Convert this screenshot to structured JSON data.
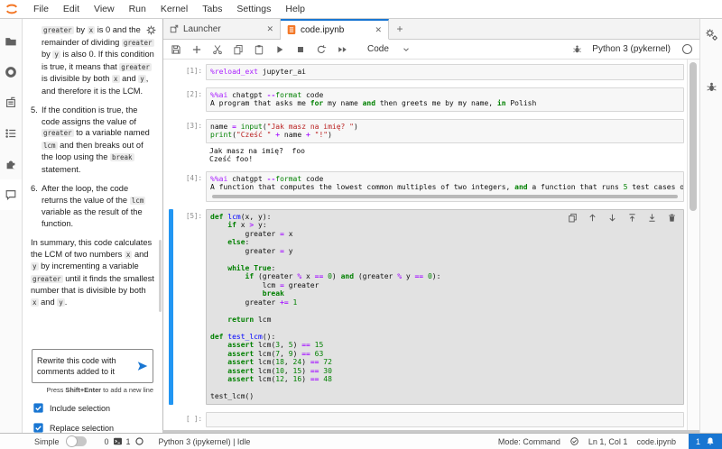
{
  "app": {
    "accent": "#1976d2",
    "selection_blue": "#2196f3",
    "brand_orange": "#f37726"
  },
  "menubar": {
    "items": [
      "File",
      "Edit",
      "View",
      "Run",
      "Kernel",
      "Tabs",
      "Settings",
      "Help"
    ]
  },
  "left_activity_bar": {
    "icons": [
      "file-browser",
      "running-kernels",
      "property-inspector",
      "table-of-contents",
      "extensions",
      "chat"
    ]
  },
  "chat_panel": {
    "paragraphs": [
      {
        "hang": true,
        "segments": [
          [
            "c",
            "greater"
          ],
          [
            "t",
            " by "
          ],
          [
            "c",
            "x"
          ],
          [
            "t",
            " is 0 and the remainder of dividing "
          ],
          [
            "c",
            "greater"
          ],
          [
            "t",
            " by "
          ],
          [
            "c",
            "y"
          ],
          [
            "t",
            " is also 0. If this condition is true, it means that "
          ],
          [
            "c",
            "greater"
          ],
          [
            "t",
            " is divisible by both "
          ],
          [
            "c",
            "x"
          ],
          [
            "t",
            " and "
          ],
          [
            "c",
            "y"
          ],
          [
            "t",
            ", and therefore it is the LCM."
          ]
        ]
      },
      {
        "num": "5.",
        "segments": [
          [
            "t",
            "If the condition is true, the code assigns the value of "
          ],
          [
            "c",
            "greater"
          ],
          [
            "t",
            " to a variable named "
          ],
          [
            "c",
            "lcm"
          ],
          [
            "t",
            " and then breaks out of the loop using the "
          ],
          [
            "c",
            "break"
          ],
          [
            "t",
            " statement."
          ]
        ]
      },
      {
        "num": "6.",
        "segments": [
          [
            "t",
            "After the loop, the code returns the value of the "
          ],
          [
            "c",
            "lcm"
          ],
          [
            "t",
            " variable as the result of the function."
          ]
        ]
      },
      {
        "segments": [
          [
            "t",
            "In summary, this code calculates the LCM of two numbers "
          ],
          [
            "c",
            "x"
          ],
          [
            "t",
            " and "
          ],
          [
            "c",
            "y"
          ],
          [
            "t",
            " by incrementing a variable "
          ],
          [
            "c",
            "greater"
          ],
          [
            "t",
            " until it finds the smallest number that is divisible by both "
          ],
          [
            "c",
            "x"
          ],
          [
            "t",
            " and "
          ],
          [
            "c",
            "y"
          ],
          [
            "t",
            "."
          ]
        ]
      }
    ],
    "input": {
      "value": "Rewrite this code with comments added to it"
    },
    "hint": {
      "prefix": "Press ",
      "key": "Shift+Enter",
      "suffix": " to add a new line"
    },
    "checkboxes": [
      {
        "label": "Include selection",
        "checked": true
      },
      {
        "label": "Replace selection",
        "checked": true
      }
    ]
  },
  "tab_bar": {
    "tabs": [
      {
        "label": "Launcher",
        "icon": "launcher-icon",
        "active": false
      },
      {
        "label": "code.ipynb",
        "icon": "notebook-icon",
        "active": true
      }
    ],
    "new_tab_label": "+"
  },
  "nb_toolbar": {
    "icons": [
      "save",
      "insert-cell-below",
      "cut-cells",
      "copy-cells",
      "paste-cells",
      "run-cell",
      "interrupt-kernel",
      "restart-kernel",
      "restart-and-run-all"
    ],
    "cell_type": "Code",
    "kernel_label": "Python 3 (pykernel)"
  },
  "right_activity_bar": {
    "icons": [
      "property-inspector-gears",
      "debugger-bug"
    ]
  },
  "cell_toolbar_icons": [
    "duplicate-cell",
    "move-cell-up",
    "move-cell-down",
    "insert-cell-above",
    "insert-cell-below",
    "delete-cell"
  ],
  "cells": [
    {
      "prompt": "[1]:",
      "lines": [
        [
          [
            "m",
            "%reload_ext"
          ],
          [
            "p",
            " jupyter_ai"
          ]
        ]
      ]
    },
    {
      "prompt": "[2]:",
      "lines": [
        [
          [
            "m",
            "%%ai"
          ],
          [
            "p",
            " chatgpt "
          ],
          [
            "o",
            "--"
          ],
          [
            "b",
            "format"
          ],
          [
            "p",
            " code"
          ]
        ],
        [
          [
            "p",
            "A program that asks me "
          ],
          [
            "k",
            "for"
          ],
          [
            "p",
            " my name "
          ],
          [
            "k",
            "and"
          ],
          [
            "p",
            " then greets me by my name, "
          ],
          [
            "k",
            "in"
          ],
          [
            "p",
            " Polish"
          ]
        ]
      ]
    },
    {
      "prompt": "[3]:",
      "lines": [
        [
          [
            "p",
            "name "
          ],
          [
            "o",
            "="
          ],
          [
            "p",
            " "
          ],
          [
            "b",
            "input"
          ],
          [
            "p",
            "("
          ],
          [
            "s",
            "\"Jak masz na imię? \""
          ],
          [
            "p",
            ")"
          ]
        ],
        [
          [
            "b",
            "print"
          ],
          [
            "p",
            "("
          ],
          [
            "s",
            "\"Cześć \""
          ],
          [
            "p",
            " "
          ],
          [
            "o",
            "+"
          ],
          [
            "p",
            " name "
          ],
          [
            "o",
            "+"
          ],
          [
            "p",
            " "
          ],
          [
            "s",
            "\"!\""
          ],
          [
            "p",
            ")"
          ]
        ]
      ],
      "outputs": [
        "Jak masz na imię?  foo",
        "Cześć foo!"
      ]
    },
    {
      "prompt": "[4]:",
      "hscroll": true,
      "lines": [
        [
          [
            "m",
            "%%ai"
          ],
          [
            "p",
            " chatgpt "
          ],
          [
            "o",
            "--"
          ],
          [
            "b",
            "format"
          ],
          [
            "p",
            " code"
          ]
        ],
        [
          [
            "p",
            "A function that computes the lowest common multiples of two integers, "
          ],
          [
            "k",
            "and"
          ],
          [
            "p",
            " a function that runs "
          ],
          [
            "n",
            "5"
          ],
          [
            "p",
            " test cases of the lowest"
          ]
        ]
      ]
    },
    {
      "prompt": "[5]:",
      "selected": true,
      "toolbar": true,
      "lines": [
        [
          [
            "k",
            "def"
          ],
          [
            "p",
            " "
          ],
          [
            "f",
            "lcm"
          ],
          [
            "p",
            "(x, y):"
          ]
        ],
        [
          [
            "p",
            "    "
          ],
          [
            "k",
            "if"
          ],
          [
            "p",
            " x "
          ],
          [
            "o",
            ">"
          ],
          [
            "p",
            " y:"
          ]
        ],
        [
          [
            "p",
            "        greater "
          ],
          [
            "o",
            "="
          ],
          [
            "p",
            " x"
          ]
        ],
        [
          [
            "p",
            "    "
          ],
          [
            "k",
            "else"
          ],
          [
            "p",
            ":"
          ]
        ],
        [
          [
            "p",
            "        greater "
          ],
          [
            "o",
            "="
          ],
          [
            "p",
            " y"
          ]
        ],
        [],
        [
          [
            "p",
            "    "
          ],
          [
            "k",
            "while"
          ],
          [
            "p",
            " "
          ],
          [
            "k",
            "True"
          ],
          [
            "p",
            ":"
          ]
        ],
        [
          [
            "p",
            "        "
          ],
          [
            "k",
            "if"
          ],
          [
            "p",
            " (greater "
          ],
          [
            "o",
            "%"
          ],
          [
            "p",
            " x "
          ],
          [
            "o",
            "=="
          ],
          [
            "p",
            " "
          ],
          [
            "n",
            "0"
          ],
          [
            "p",
            ") "
          ],
          [
            "k",
            "and"
          ],
          [
            "p",
            " (greater "
          ],
          [
            "o",
            "%"
          ],
          [
            "p",
            " y "
          ],
          [
            "o",
            "=="
          ],
          [
            "p",
            " "
          ],
          [
            "n",
            "0"
          ],
          [
            "p",
            "):"
          ]
        ],
        [
          [
            "p",
            "            lcm "
          ],
          [
            "o",
            "="
          ],
          [
            "p",
            " greater"
          ]
        ],
        [
          [
            "p",
            "            "
          ],
          [
            "k",
            "break"
          ]
        ],
        [
          [
            "p",
            "        greater "
          ],
          [
            "o",
            "+="
          ],
          [
            "p",
            " "
          ],
          [
            "n",
            "1"
          ]
        ],
        [],
        [
          [
            "p",
            "    "
          ],
          [
            "k",
            "return"
          ],
          [
            "p",
            " lcm"
          ]
        ],
        [],
        [
          [
            "k",
            "def"
          ],
          [
            "p",
            " "
          ],
          [
            "f",
            "test_lcm"
          ],
          [
            "p",
            "():"
          ]
        ],
        [
          [
            "p",
            "    "
          ],
          [
            "k",
            "assert"
          ],
          [
            "p",
            " lcm("
          ],
          [
            "n",
            "3"
          ],
          [
            "p",
            ", "
          ],
          [
            "n",
            "5"
          ],
          [
            "p",
            ") "
          ],
          [
            "o",
            "=="
          ],
          [
            "p",
            " "
          ],
          [
            "n",
            "15"
          ]
        ],
        [
          [
            "p",
            "    "
          ],
          [
            "k",
            "assert"
          ],
          [
            "p",
            " lcm("
          ],
          [
            "n",
            "7"
          ],
          [
            "p",
            ", "
          ],
          [
            "n",
            "9"
          ],
          [
            "p",
            ") "
          ],
          [
            "o",
            "=="
          ],
          [
            "p",
            " "
          ],
          [
            "n",
            "63"
          ]
        ],
        [
          [
            "p",
            "    "
          ],
          [
            "k",
            "assert"
          ],
          [
            "p",
            " lcm("
          ],
          [
            "n",
            "18"
          ],
          [
            "p",
            ", "
          ],
          [
            "n",
            "24"
          ],
          [
            "p",
            ") "
          ],
          [
            "o",
            "=="
          ],
          [
            "p",
            " "
          ],
          [
            "n",
            "72"
          ]
        ],
        [
          [
            "p",
            "    "
          ],
          [
            "k",
            "assert"
          ],
          [
            "p",
            " lcm("
          ],
          [
            "n",
            "10"
          ],
          [
            "p",
            ", "
          ],
          [
            "n",
            "15"
          ],
          [
            "p",
            ") "
          ],
          [
            "o",
            "=="
          ],
          [
            "p",
            " "
          ],
          [
            "n",
            "30"
          ]
        ],
        [
          [
            "p",
            "    "
          ],
          [
            "k",
            "assert"
          ],
          [
            "p",
            " lcm("
          ],
          [
            "n",
            "12"
          ],
          [
            "p",
            ", "
          ],
          [
            "n",
            "16"
          ],
          [
            "p",
            ") "
          ],
          [
            "o",
            "=="
          ],
          [
            "p",
            " "
          ],
          [
            "n",
            "48"
          ]
        ],
        [],
        [
          [
            "p",
            "test_lcm()"
          ]
        ]
      ]
    },
    {
      "prompt": "[ ]:",
      "lines": [
        []
      ]
    }
  ],
  "statusbar": {
    "simple_label": "Simple",
    "terminals_count": "0",
    "kernels_count": "1",
    "kernel_status": "Python 3 (ipykernel) | Idle",
    "mode_label": "Mode: Command",
    "cursor_position": "Ln 1, Col 1",
    "filename": "code.ipynb",
    "notifications_count": "1"
  }
}
